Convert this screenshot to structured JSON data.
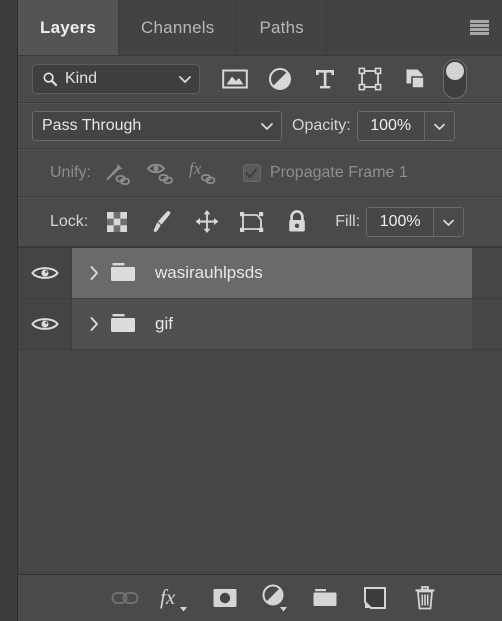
{
  "panel": {
    "tabs": [
      {
        "label": "Layers",
        "active": true
      },
      {
        "label": "Channels",
        "active": false
      },
      {
        "label": "Paths",
        "active": false
      }
    ],
    "menu_icon": "hamburger-menu-icon"
  },
  "filter": {
    "kind_label": "Kind",
    "search_icon": "search-icon",
    "chevron_icon": "chevron-down-icon",
    "type_filters": [
      {
        "name": "pixel-layers-filter",
        "icon": "image-icon"
      },
      {
        "name": "adjustment-layers-filter",
        "icon": "half-circle-icon"
      },
      {
        "name": "type-layers-filter",
        "icon": "text-t-icon"
      },
      {
        "name": "shape-layers-filter",
        "icon": "shape-handles-icon"
      },
      {
        "name": "smart-object-filter",
        "icon": "smart-object-icon"
      }
    ],
    "toggle_state": "off"
  },
  "blend": {
    "mode": "Pass Through",
    "opacity_label": "Opacity:",
    "opacity_value": "100%"
  },
  "unify": {
    "label": "Unify:",
    "icons": [
      {
        "name": "unify-position-icon",
        "icon": "pin-link-icon"
      },
      {
        "name": "unify-visibility-icon",
        "icon": "eye-link-icon"
      },
      {
        "name": "unify-style-icon",
        "icon": "fx-link-icon"
      }
    ],
    "propagate_label": "Propagate Frame 1",
    "propagate_checked": true,
    "disabled": true
  },
  "lock": {
    "label": "Lock:",
    "icons": [
      {
        "name": "lock-transparent-pixels",
        "icon": "checkerboard-icon"
      },
      {
        "name": "lock-image-pixels",
        "icon": "brush-icon"
      },
      {
        "name": "lock-position",
        "icon": "move-arrows-icon"
      },
      {
        "name": "lock-artboard-nesting",
        "icon": "artboard-icon"
      },
      {
        "name": "lock-all",
        "icon": "padlock-icon"
      }
    ],
    "fill_label": "Fill:",
    "fill_value": "100%"
  },
  "layers": [
    {
      "name": "wasirauhlpsds",
      "type": "group",
      "visible": true,
      "selected": true,
      "expanded": false
    },
    {
      "name": "gif",
      "type": "group",
      "visible": true,
      "selected": false,
      "expanded": false
    }
  ],
  "bottom_bar": {
    "buttons": [
      {
        "name": "link-layers-button",
        "icon": "link-icon",
        "disabled": true
      },
      {
        "name": "layer-styles-button",
        "icon": "fx-icon",
        "disabled": false
      },
      {
        "name": "add-layer-mask-button",
        "icon": "layer-mask-icon",
        "disabled": false
      },
      {
        "name": "new-adjustment-layer-button",
        "icon": "half-circle-icon",
        "disabled": false
      },
      {
        "name": "new-group-button",
        "icon": "folder-icon",
        "disabled": false
      },
      {
        "name": "new-layer-button",
        "icon": "new-layer-icon",
        "disabled": false
      },
      {
        "name": "delete-layer-button",
        "icon": "trash-icon",
        "disabled": false
      }
    ]
  },
  "colors": {
    "panel_bg": "#4a4a4a",
    "tab_active_bg": "#545454",
    "row_selected_bg": "#6a6a6a",
    "text": "#e6e6e6",
    "text_dim": "#8d8d8d"
  }
}
